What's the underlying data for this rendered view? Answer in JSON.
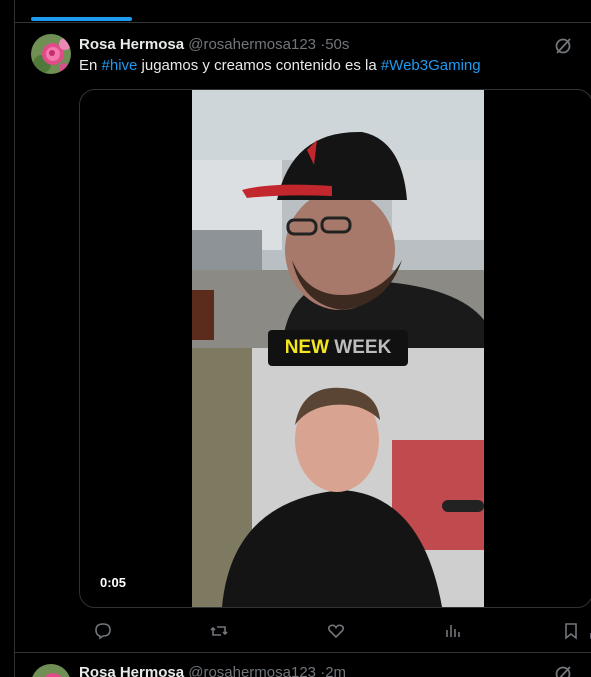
{
  "tweet1": {
    "name": "Rosa Hermosa",
    "handle": "@rosahermosa123",
    "separator": "·",
    "time": "50s",
    "text_parts": [
      "En ",
      "#hive",
      " jugamos y creamos contenido es la ",
      "#Web3Gaming"
    ],
    "video": {
      "timestamp": "0:05",
      "overlay_word1": "NEW",
      "overlay_word2": "WEEK"
    }
  },
  "tweet2": {
    "name": "Rosa Hermosa",
    "handle": "@rosahermosa123",
    "separator": "·",
    "time": "2m"
  },
  "actions": [
    "reply-icon",
    "retweet-icon",
    "like-icon",
    "views-icon",
    "bookmark-icon",
    "share-icon"
  ],
  "colors": {
    "accent": "#1d9bf0",
    "border": "#2f3336",
    "muted": "#71767b",
    "text": "#e7e9ea"
  }
}
